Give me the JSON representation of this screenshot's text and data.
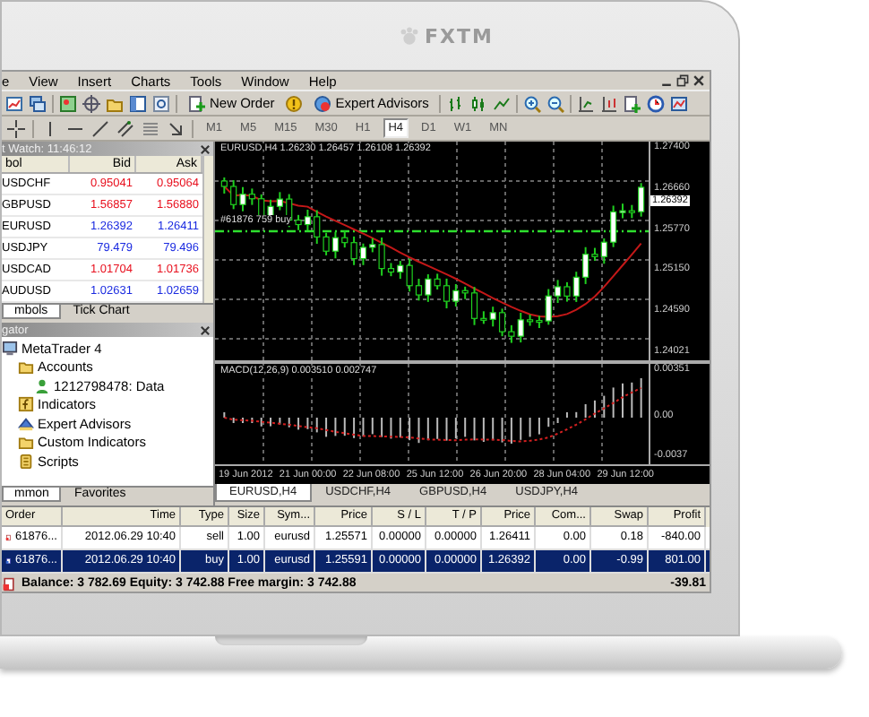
{
  "bezel": {
    "logo": "FXTM"
  },
  "menu": [
    "e",
    "View",
    "Insert",
    "Charts",
    "Tools",
    "Window",
    "Help"
  ],
  "toolbar": {
    "buttons": [
      "New Order",
      "Expert Advisors"
    ]
  },
  "periods": [
    {
      "label": "M1",
      "selected": false
    },
    {
      "label": "M5",
      "selected": false
    },
    {
      "label": "M15",
      "selected": false
    },
    {
      "label": "M30",
      "selected": false
    },
    {
      "label": "H1",
      "selected": false
    },
    {
      "label": "H4",
      "selected": true
    },
    {
      "label": "D1",
      "selected": false
    },
    {
      "label": "W1",
      "selected": false
    },
    {
      "label": "MN",
      "selected": false
    }
  ],
  "market_watch": {
    "title": "t Watch: 11:46:12",
    "columns": [
      "bol",
      "Bid",
      "Ask"
    ],
    "rows": [
      {
        "symbol": "USDCHF",
        "bid": "0.95041",
        "ask": "0.95064",
        "color": "#e8101e"
      },
      {
        "symbol": "GBPUSD",
        "bid": "1.56857",
        "ask": "1.56880",
        "color": "#e8101e"
      },
      {
        "symbol": "EURUSD",
        "bid": "1.26392",
        "ask": "1.26411",
        "color": "#1a2ae0"
      },
      {
        "symbol": "USDJPY",
        "bid": "79.479",
        "ask": "79.496",
        "color": "#1a2ae0"
      },
      {
        "symbol": "USDCAD",
        "bid": "1.01704",
        "ask": "1.01736",
        "color": "#e8101e"
      },
      {
        "symbol": "AUDUSD",
        "bid": "1.02631",
        "ask": "1.02659",
        "color": "#1a2ae0"
      }
    ],
    "tabs": [
      {
        "label": "mbols",
        "selected": true
      },
      {
        "label": "Tick Chart",
        "selected": false
      }
    ]
  },
  "navigator": {
    "title": "gator",
    "tree": [
      {
        "label": "MetaTrader 4",
        "kind": "root",
        "children": [
          {
            "label": "Accounts",
            "kind": "folder",
            "children": [
              {
                "label": "1212798478: Data",
                "kind": "account"
              }
            ]
          },
          {
            "label": "Indicators",
            "kind": "indicators"
          },
          {
            "label": "Expert Advisors",
            "kind": "experts"
          },
          {
            "label": "Custom Indicators",
            "kind": "folder"
          },
          {
            "label": "Scripts",
            "kind": "scripts"
          }
        ]
      }
    ],
    "tabs": [
      {
        "label": "mmon",
        "selected": true
      },
      {
        "label": "Favorites",
        "selected": false
      }
    ]
  },
  "chart": {
    "header": "EURUSD,H4 1.26230 1.26457 1.26108 1.26392",
    "order_label": "#61876 759 buy",
    "price_ticks": [
      "1.27400",
      "1.26660",
      "1.25770",
      "1.25150",
      "1.24590",
      "1.24021"
    ],
    "current_price": "1.26392",
    "indicator_label": "MACD(12,26,9) 0.003510 0.002747",
    "indicator_ticks": [
      "0.00351",
      "0.00",
      "-0.0037"
    ],
    "time_ticks": [
      "19 Jun 2012",
      "21 Jun 00:00",
      "22 Jun 08:00",
      "25 Jun 12:00",
      "26 Jun 20:00",
      "28 Jun 04:00",
      "29 Jun 12:00"
    ]
  },
  "chart_tabs": [
    {
      "label": "EURUSD,H4",
      "selected": true
    },
    {
      "label": "USDCHF,H4",
      "selected": false
    },
    {
      "label": "GBPUSD,H4",
      "selected": false
    },
    {
      "label": "USDJPY,H4",
      "selected": false
    }
  ],
  "terminal": {
    "columns": [
      "Order",
      "Time",
      "Type",
      "Size",
      "Sym...",
      "Price",
      "S / L",
      "T / P",
      "Price",
      "Com...",
      "Swap",
      "Profit"
    ],
    "rows": [
      {
        "kind": "sell",
        "selected": false,
        "cells": [
          "61876...",
          "2012.06.29 10:40",
          "sell",
          "1.00",
          "eurusd",
          "1.25571",
          "0.00000",
          "0.00000",
          "1.26411",
          "0.00",
          "0.18",
          "-840.00"
        ]
      },
      {
        "kind": "buy",
        "selected": true,
        "cells": [
          "61876...",
          "2012.06.29 10:40",
          "buy",
          "1.00",
          "eurusd",
          "1.25591",
          "0.00000",
          "0.00000",
          "1.26392",
          "0.00",
          "-0.99",
          "801.00"
        ]
      }
    ],
    "summary": "Balance: 3 782.69 Equity: 3 742.88 Free margin: 3 742.88",
    "total": "-39.81"
  }
}
